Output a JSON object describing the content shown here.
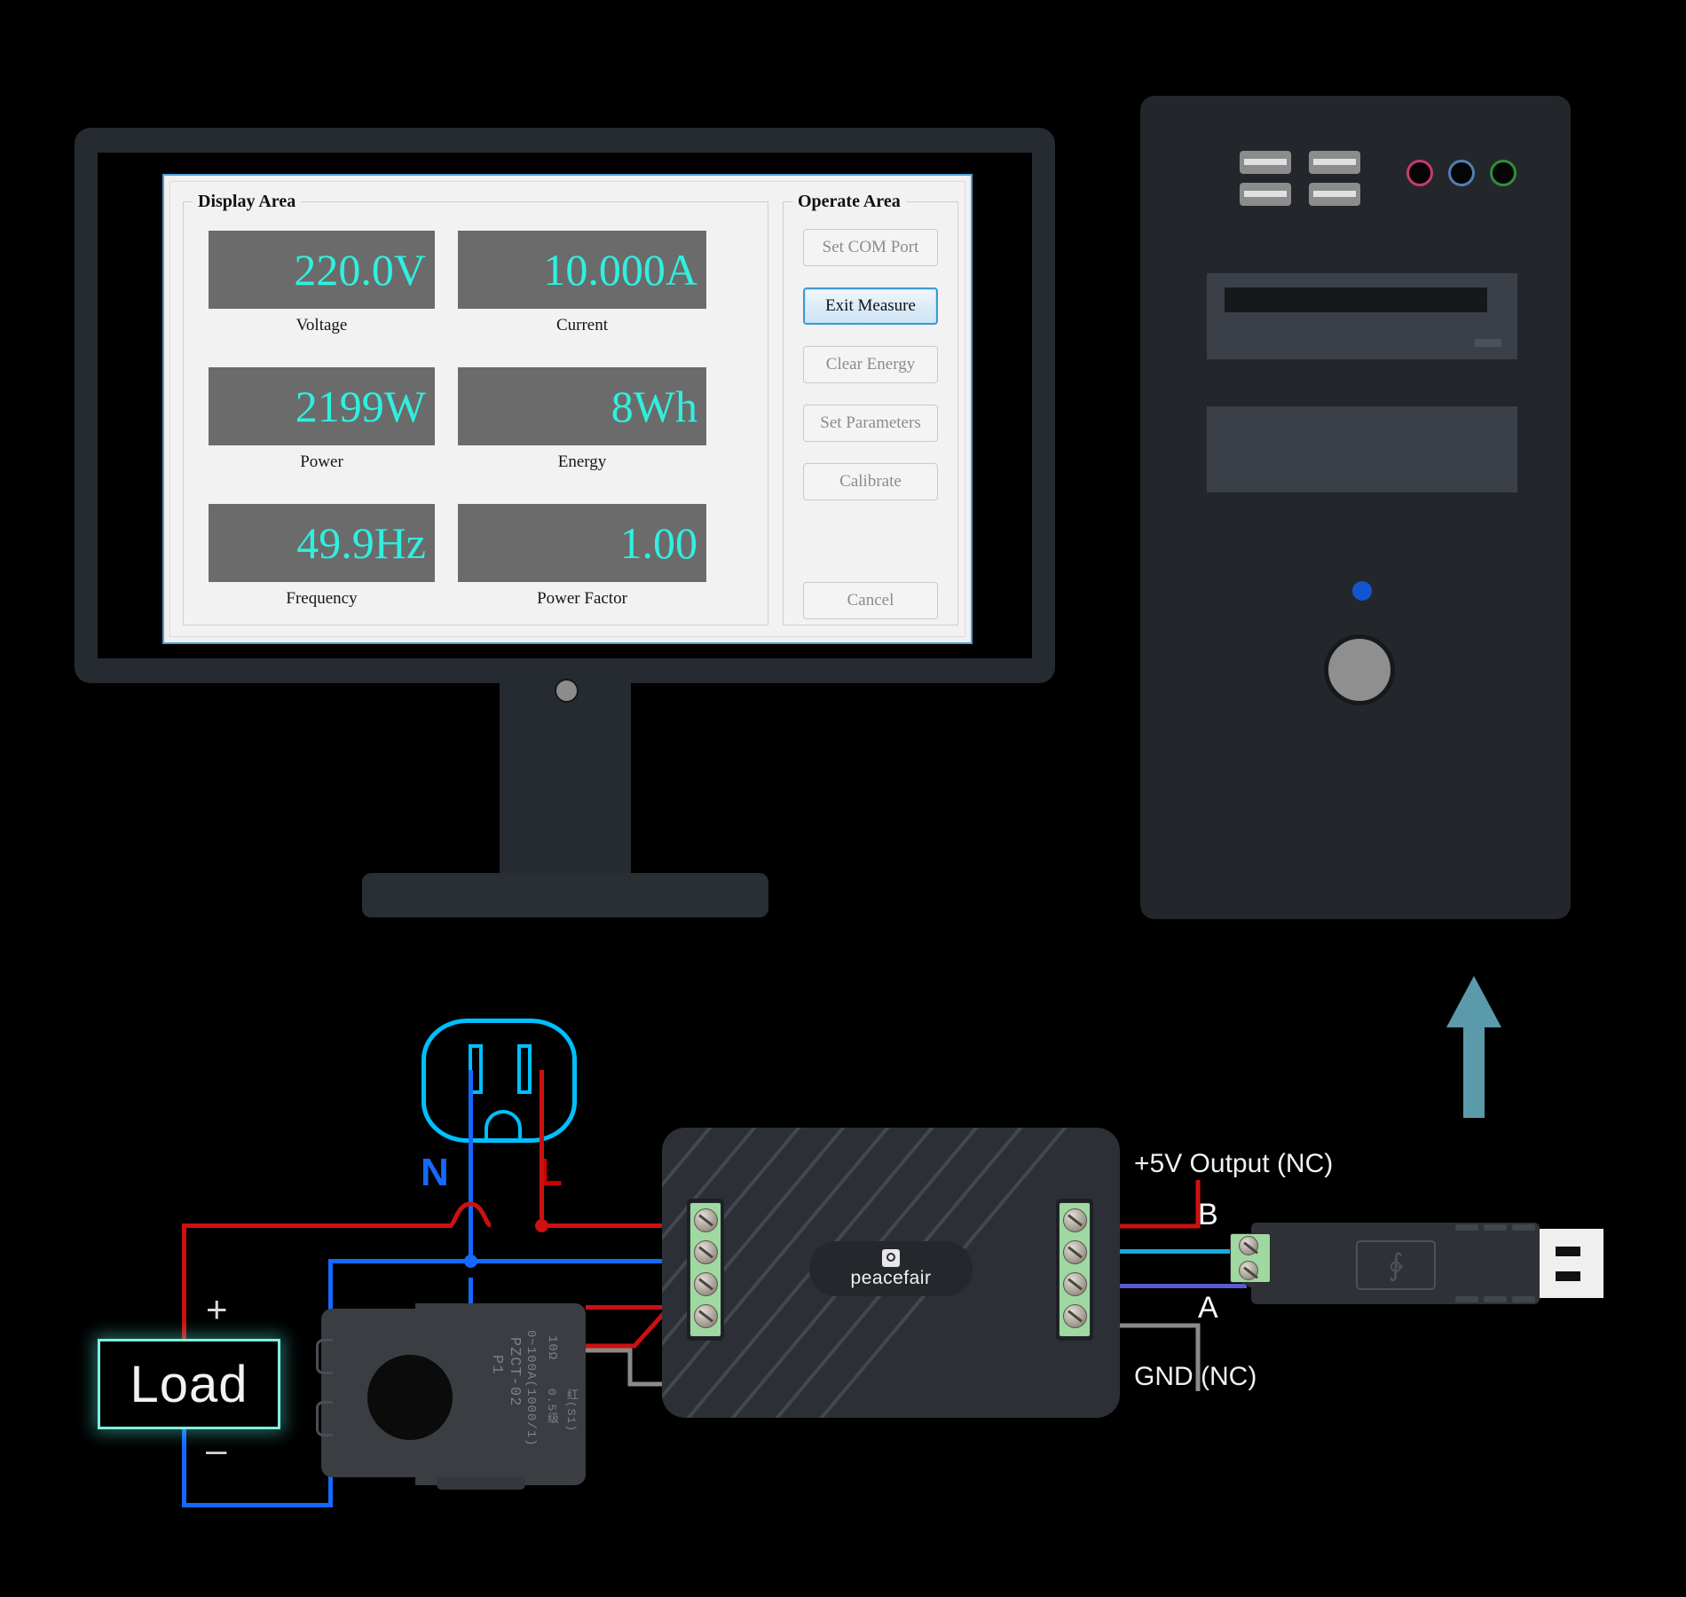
{
  "app": {
    "display_area": {
      "title": "Display Area",
      "readouts": [
        {
          "label": "Voltage",
          "value": "220.0V"
        },
        {
          "label": "Current",
          "value": "10.000A"
        },
        {
          "label": "Power",
          "value": "2199W"
        },
        {
          "label": "Energy",
          "value": "8Wh"
        },
        {
          "label": "Frequency",
          "value": "49.9Hz"
        },
        {
          "label": "Power Factor",
          "value": "1.00"
        }
      ]
    },
    "operate_area": {
      "title": "Operate Area",
      "buttons": [
        {
          "label": "Set COM Port",
          "state": "disabled"
        },
        {
          "label": "Exit Measure",
          "state": "active"
        },
        {
          "label": "Clear Energy",
          "state": "disabled"
        },
        {
          "label": "Set Parameters",
          "state": "disabled"
        },
        {
          "label": "Calibrate",
          "state": "disabled"
        },
        {
          "label": "Cancel",
          "state": "disabled"
        }
      ]
    },
    "colors": {
      "readout_value": "#2ff0e0",
      "readout_background": "#6b6b6b",
      "window_border": "#4a9fd8",
      "active_button_border": "#3c9ad4"
    }
  },
  "diagram": {
    "load_label": "Load",
    "load_plus": "+",
    "load_minus": "–",
    "outlet": {
      "neutral_label": "N",
      "live_label": "L"
    },
    "ct_clamp": {
      "lines": [
        "P1",
        "PZCT-02",
        "0~100A(1000/1)",
        "0.5级",
        "10Ω",
        "红(S1)"
      ]
    },
    "meter_brand": "peacefair",
    "annotations": {
      "five_volt": "+5V Output (NC)",
      "gnd": "GND (NC)",
      "pin_b": "B",
      "pin_a": "A"
    },
    "wire_colors": {
      "live": "#cc1111",
      "neutral": "#1569ff",
      "rs485_b": "#19a9df",
      "rs485_a": "#5a5ad4",
      "gnd": "#8a8a8a",
      "outlet_outline": "#00bfff",
      "arrow": "#5b9aab",
      "load_glow": "#7ff0e0"
    }
  },
  "hardware": {
    "pc_tower": {
      "usb_ports": [
        "usb-port-1",
        "usb-port-2",
        "usb-port-3",
        "usb-port-4"
      ],
      "audio_jacks": [
        {
          "name": "microphone-jack",
          "color": "#c73a72"
        },
        {
          "name": "line-in-jack",
          "color": "#4f7fb5"
        },
        {
          "name": "line-out-jack",
          "color": "#2f8f3a"
        }
      ],
      "power_led_color": "#1256cf",
      "power_button_color": "#8f8f8f"
    },
    "monitor": {
      "indicator_color": "#8c8c8c"
    }
  }
}
